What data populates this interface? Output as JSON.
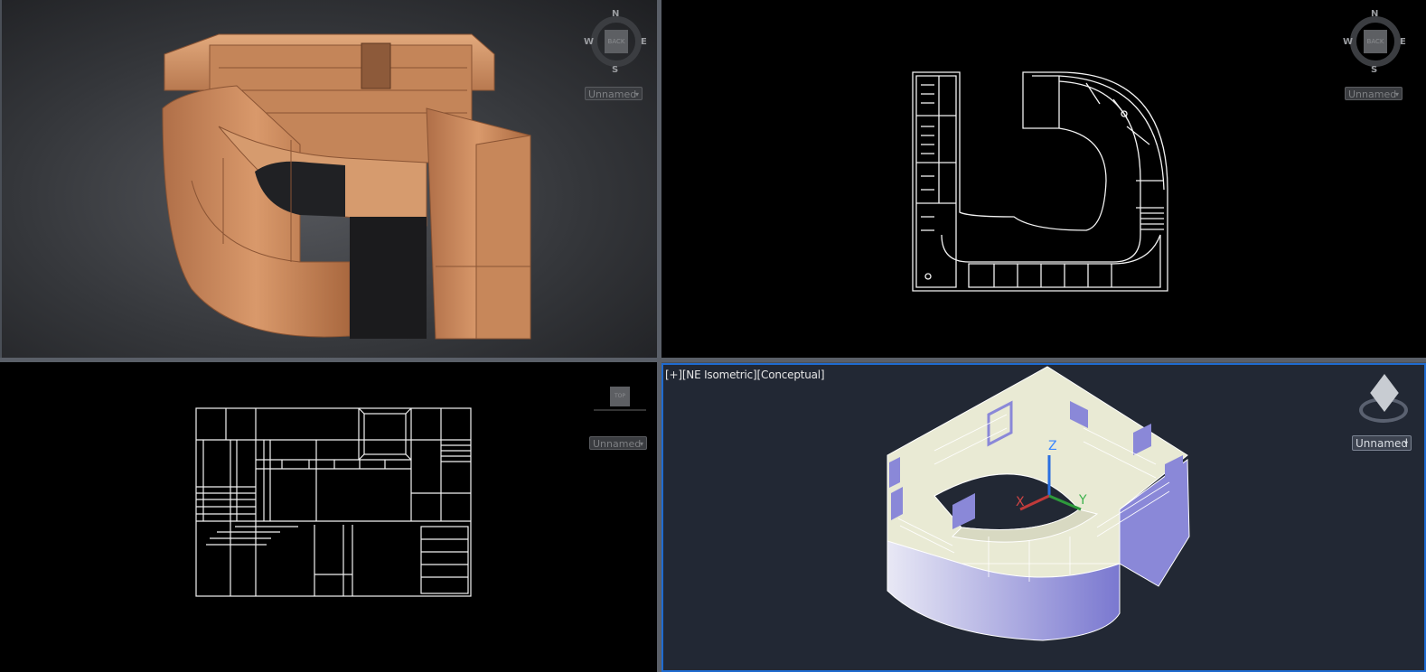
{
  "viewports": {
    "top_left": {
      "compass": {
        "n": "N",
        "s": "S",
        "e": "E",
        "w": "W",
        "cube": "BACK"
      },
      "view_dropdown": "Unnamed"
    },
    "top_right": {
      "compass": {
        "n": "N",
        "s": "S",
        "e": "E",
        "w": "W",
        "cube": "BACK"
      },
      "view_dropdown": "Unnamed"
    },
    "bottom_left": {
      "view_dropdown": "Unnamed",
      "cube_label": "TOP"
    },
    "bottom_right": {
      "label": "[+][NE Isometric][Conceptual]",
      "view_dropdown": "Unnamed",
      "axes": {
        "x": "X",
        "y": "Y",
        "z": "Z"
      }
    }
  },
  "colors": {
    "accent": "#1f6bd0",
    "wood": "#c98a5e",
    "conceptual_fill": "#e9ead4",
    "conceptual_side": "#8a88d8"
  }
}
